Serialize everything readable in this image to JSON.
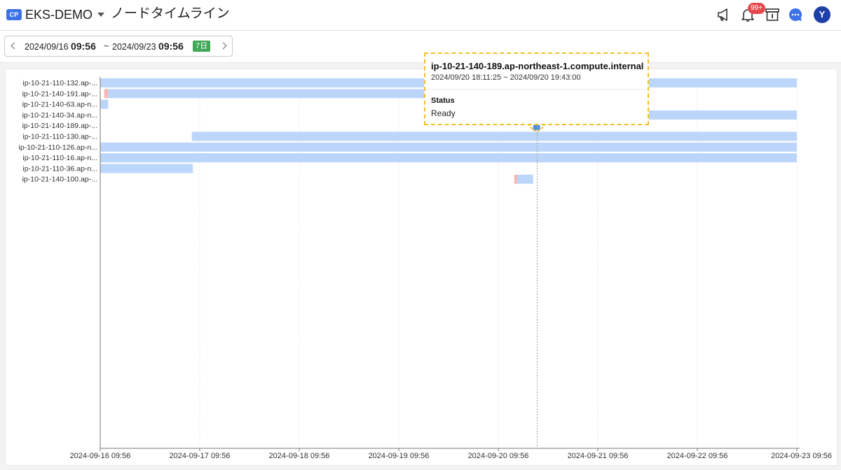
{
  "header": {
    "project_badge": "CP",
    "project_name": "EKS-DEMO",
    "page_title": "ノードタイムライン",
    "notification_count": "99+",
    "avatar_letter": "Y",
    "icons": [
      "megaphone-icon",
      "bell-icon",
      "archive-icon",
      "chat-icon"
    ]
  },
  "range": {
    "start_date": "2024/09/16",
    "start_time": "09:56",
    "separator": "~",
    "end_date": "2024/09/23",
    "end_time": "09:56",
    "days_badge": "7日"
  },
  "colors": {
    "accent": "#3d72e6",
    "bar_ready": "#bcd6fb",
    "bar_notready": "#f7b8b4",
    "badge_green": "#3fa857",
    "notif_red": "#e5484d",
    "highlight": "#f1c02a"
  },
  "chart_data": {
    "type": "timeline",
    "x_range": [
      "2024-09-16 09:56",
      "2024-09-23 09:56"
    ],
    "x_ticks": [
      "2024-09-16 09:56",
      "2024-09-17 09:56",
      "2024-09-18 09:56",
      "2024-09-19 09:56",
      "2024-09-20 09:56",
      "2024-09-21 09:56",
      "2024-09-22 09:56",
      "2024-09-23 09:56"
    ],
    "rows": [
      {
        "label": "ip-10-21-110-132.ap-...",
        "segments": [
          {
            "start": 0.0,
            "end": 7.0,
            "status": "Ready"
          }
        ]
      },
      {
        "label": "ip-10-21-140-191.ap-...",
        "segments": [
          {
            "start": 0.04,
            "end": 0.08,
            "status": "NotReady"
          },
          {
            "start": 0.08,
            "end": 3.36,
            "status": "Ready"
          }
        ]
      },
      {
        "label": "ip-10-21-140-63.ap-n...",
        "segments": [
          {
            "start": 0.0,
            "end": 0.08,
            "status": "Ready"
          }
        ]
      },
      {
        "label": "ip-10-21-140-34.ap-n...",
        "segments": [
          {
            "start": 5.5,
            "end": 7.0,
            "status": "Ready"
          }
        ]
      },
      {
        "label": "ip-10-21-140-189.ap-...",
        "segments": [
          {
            "start": 4.35,
            "end": 4.42,
            "status": "Ready"
          }
        ]
      },
      {
        "label": "ip-10-21-110-130.ap-...",
        "segments": [
          {
            "start": 0.92,
            "end": 7.0,
            "status": "Ready"
          }
        ]
      },
      {
        "label": "ip-10-21-110-126.ap-n...",
        "segments": [
          {
            "start": 0.0,
            "end": 7.0,
            "status": "Ready"
          }
        ]
      },
      {
        "label": "ip-10-21-110-16.ap-n...",
        "segments": [
          {
            "start": 0.0,
            "end": 7.0,
            "status": "Ready"
          }
        ]
      },
      {
        "label": "ip-10-21-110-36.ap-n...",
        "segments": [
          {
            "start": 0.0,
            "end": 0.93,
            "status": "Ready"
          }
        ]
      },
      {
        "label": "ip-10-21-140-100.ap-...",
        "segments": [
          {
            "start": 4.16,
            "end": 4.19,
            "status": "NotReady"
          },
          {
            "start": 4.19,
            "end": 4.35,
            "status": "Ready"
          }
        ]
      }
    ],
    "highlight_row": 4,
    "crosshair_x": 4.39
  },
  "tooltip": {
    "title": "ip-10-21-140-189.ap-northeast-1.compute.internal",
    "range": "2024/09/20 18:11:25 ~ 2024/09/20 19:43:00",
    "field_label": "Status",
    "field_value": "Ready"
  }
}
